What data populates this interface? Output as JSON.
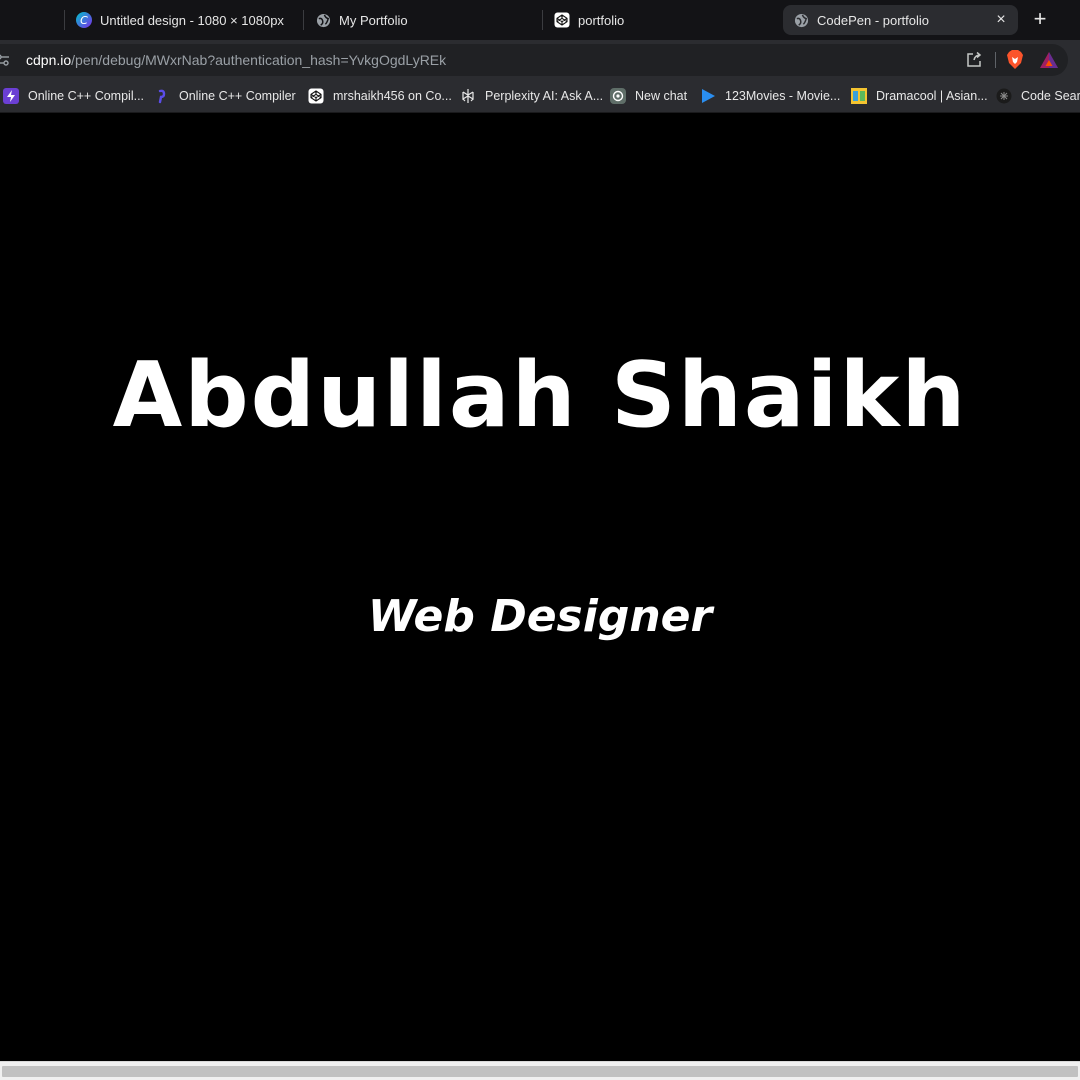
{
  "tabs": [
    {
      "title": "Untitled design - 1080 × 1080px",
      "icon": "canva-icon",
      "active": false
    },
    {
      "title": "My Portfolio",
      "icon": "globe-icon",
      "active": false
    },
    {
      "title": "portfolio",
      "icon": "codepen-icon",
      "active": false
    },
    {
      "title": "CodePen - portfolio",
      "icon": "globe-icon",
      "active": true
    }
  ],
  "tab_close_glyph": "×",
  "new_tab_glyph": "+",
  "address": {
    "host": "cdpn.io",
    "path": "/pen/debug/MWxrNab?authentication_hash=YvkgOgdLyREk"
  },
  "bookmarks": [
    {
      "label": "Online C++ Compil...",
      "icon": "lightning-icon"
    },
    {
      "label": "Online C++ Compiler",
      "icon": "programiz-icon"
    },
    {
      "label": "mrshaikh456 on Co...",
      "icon": "codepen-icon"
    },
    {
      "label": "Perplexity AI: Ask A...",
      "icon": "perplexity-icon"
    },
    {
      "label": "New chat",
      "icon": "chatgpt-icon"
    },
    {
      "label": "123Movies - Movie...",
      "icon": "play-icon"
    },
    {
      "label": "Dramacool | Asian...",
      "icon": "dramacool-icon"
    },
    {
      "label": "Code Search",
      "icon": "code-search-icon"
    }
  ],
  "page": {
    "name": "Abdullah Shaikh",
    "role": "Web Designer",
    "background": "#000000",
    "text_color": "#ffffff"
  },
  "colors": {
    "tab_strip": "#131316",
    "toolbar": "#2b2c30",
    "omnibox": "#202124",
    "brave_orange": "#fb542b"
  }
}
